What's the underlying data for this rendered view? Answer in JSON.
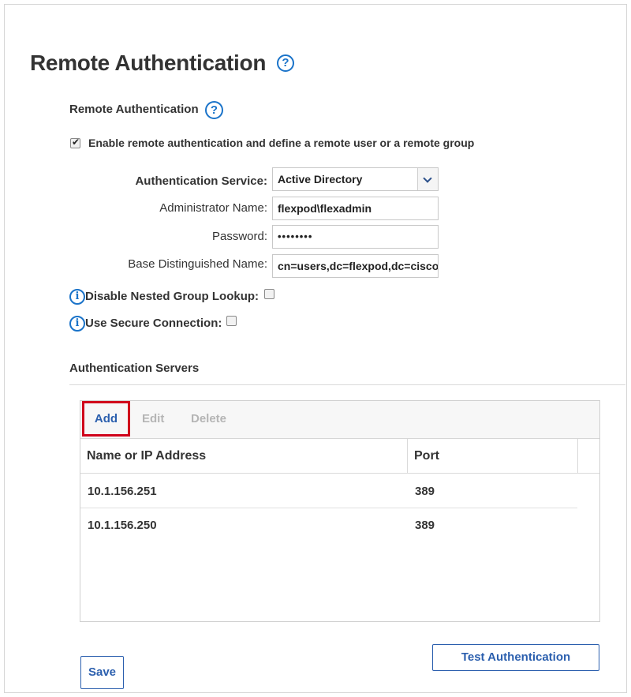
{
  "page": {
    "title": "Remote Authentication"
  },
  "remote_auth": {
    "section_label": "Remote Authentication",
    "enable_label": "Enable remote authentication and define a remote user or a remote group",
    "enable_checked": true
  },
  "form": {
    "service_label": "Authentication Service:",
    "service_value": "Active Directory",
    "admin_label": "Administrator Name:",
    "admin_value": "flexpod\\flexadmin",
    "password_label": "Password:",
    "password_value": "••••••••",
    "basedn_label": "Base Distinguished Name:",
    "basedn_value": "cn=users,dc=flexpod,dc=cisco,"
  },
  "options": {
    "nested_label": "Disable Nested Group Lookup:",
    "nested_checked": false,
    "secure_label": "Use Secure Connection:",
    "secure_checked": false
  },
  "servers": {
    "section_label": "Authentication Servers",
    "toolbar": {
      "add": "Add",
      "edit": "Edit",
      "delete": "Delete"
    },
    "columns": {
      "name": "Name or IP Address",
      "port": "Port"
    },
    "rows": [
      {
        "name": "10.1.156.251",
        "port": "389"
      },
      {
        "name": "10.1.156.250",
        "port": "389"
      }
    ]
  },
  "actions": {
    "test": "Test Authentication",
    "save": "Save"
  },
  "colors": {
    "accent": "#2b5fae",
    "help_icon": "#1a73c9",
    "highlight": "#d0021b"
  },
  "icons": {
    "help": "question-circle-icon",
    "info": "info-circle-icon",
    "dropdown": "chevron-down-icon"
  }
}
